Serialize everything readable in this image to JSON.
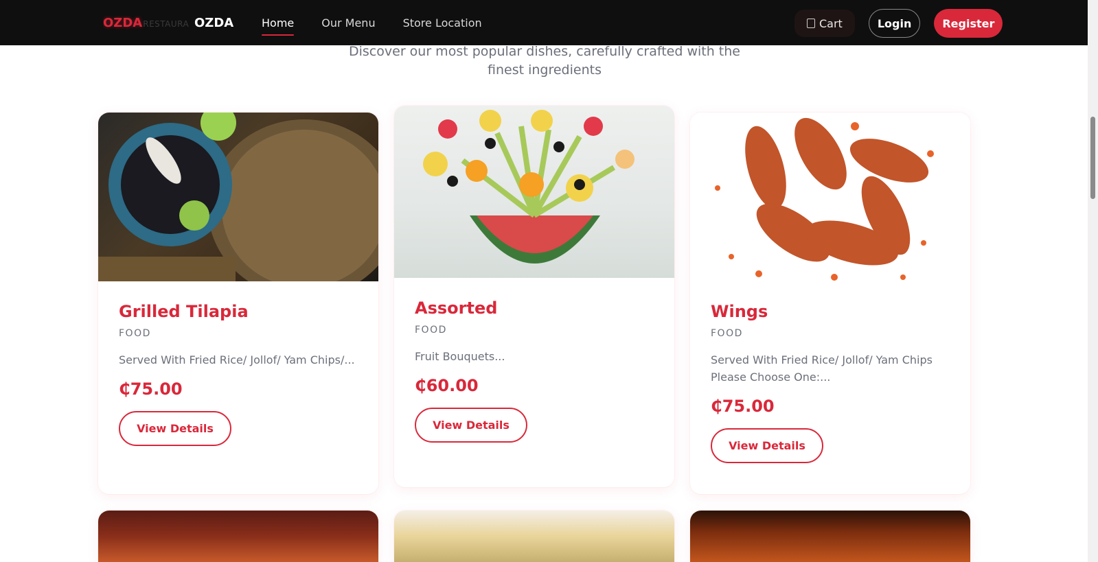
{
  "header": {
    "logo_main": "OZDA",
    "logo_sub": "RESTAURA",
    "brand_name": "OZDA",
    "nav": [
      {
        "label": "Home",
        "active": true
      },
      {
        "label": "Our Menu",
        "active": false
      },
      {
        "label": "Store Location",
        "active": false
      }
    ],
    "cart_label": "Cart",
    "login_label": "Login",
    "register_label": "Register"
  },
  "section": {
    "subtitle": "Discover our most popular dishes, carefully crafted with the finest ingredients"
  },
  "cards": [
    {
      "title": "Grilled Tilapia",
      "category": "FOOD",
      "description": "Served With Fried Rice/ Jollof/ Yam Chips/...",
      "price": "₵75.00",
      "button": "View Details",
      "image": "grilled-tilapia-photo"
    },
    {
      "title": "Assorted",
      "category": "FOOD",
      "description": "Fruit Bouquets...",
      "price": "₵60.00",
      "button": "View Details",
      "image": "fruit-bouquet-photo"
    },
    {
      "title": "Wings",
      "category": "FOOD",
      "description": "Served With Fried Rice/ Jollof/ Yam Chips Please Choose One:...",
      "price": "₵75.00",
      "button": "View Details",
      "image": "chicken-wings-photo"
    }
  ],
  "colors": {
    "accent": "#d9283a",
    "nav_bg": "#0f0f0f",
    "muted_text": "#6b6f7a"
  }
}
